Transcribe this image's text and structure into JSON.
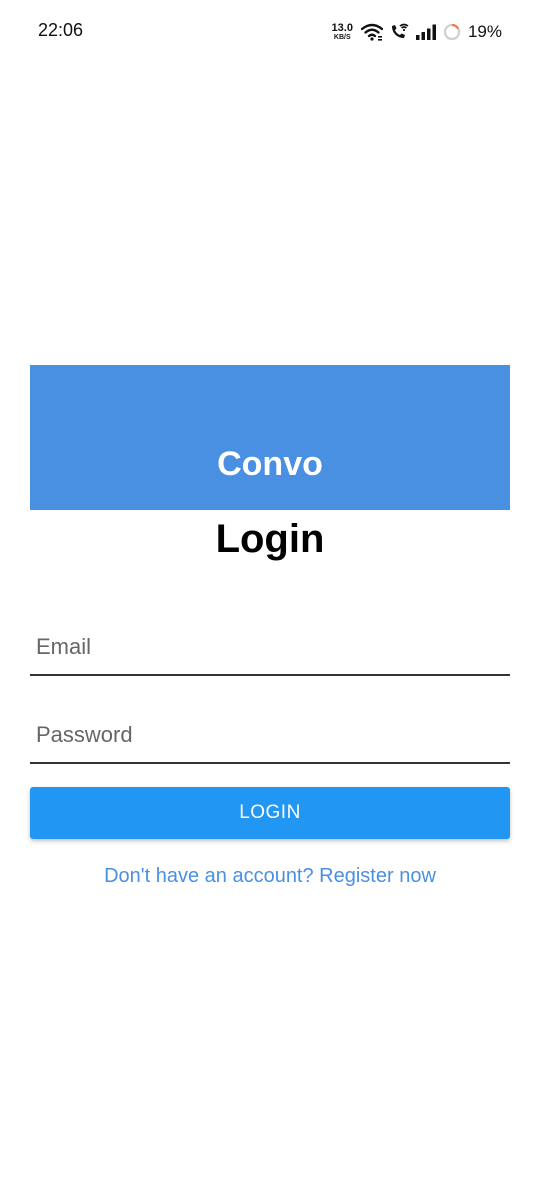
{
  "status_bar": {
    "time": "22:06",
    "net_speed_value": "13.0",
    "net_speed_unit": "KB/S",
    "battery_percent": "19%",
    "icons": [
      "wifi-icon",
      "wifi-call-icon",
      "signal-icon",
      "battery-ring-icon"
    ]
  },
  "header": {
    "app_title": "Convo",
    "background_color": "#4a90e2"
  },
  "page": {
    "title": "Login"
  },
  "form": {
    "email": {
      "placeholder": "Email",
      "value": ""
    },
    "password": {
      "placeholder": "Password",
      "value": ""
    },
    "login_label": "LOGIN",
    "login_color": "#2196f3",
    "register_text": "Don't have an account? Register now",
    "register_color": "#4a90e2"
  }
}
